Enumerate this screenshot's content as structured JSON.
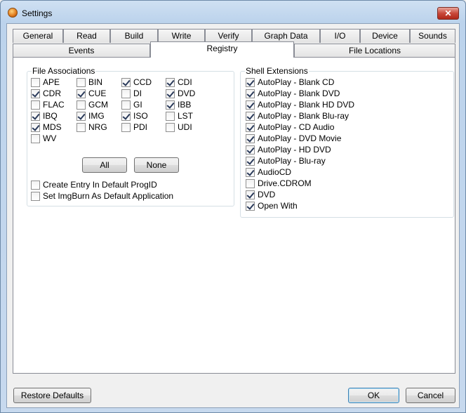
{
  "window": {
    "title": "Settings",
    "close_glyph": "✕"
  },
  "tabs_row1": [
    "General",
    "Read",
    "Build",
    "Write",
    "Verify",
    "Graph Data",
    "I/O",
    "Device",
    "Sounds"
  ],
  "tabs_row2": [
    "Events",
    "Registry",
    "File Locations"
  ],
  "active_tab": "Registry",
  "file_associations": {
    "title": "File Associations",
    "items": [
      {
        "label": "APE",
        "checked": false
      },
      {
        "label": "BIN",
        "checked": false
      },
      {
        "label": "CCD",
        "checked": true
      },
      {
        "label": "CDI",
        "checked": true
      },
      {
        "label": "CDR",
        "checked": true
      },
      {
        "label": "CUE",
        "checked": true
      },
      {
        "label": "DI",
        "checked": false
      },
      {
        "label": "DVD",
        "checked": true
      },
      {
        "label": "FLAC",
        "checked": false
      },
      {
        "label": "GCM",
        "checked": false
      },
      {
        "label": "GI",
        "checked": false
      },
      {
        "label": "IBB",
        "checked": true
      },
      {
        "label": "IBQ",
        "checked": true
      },
      {
        "label": "IMG",
        "checked": true
      },
      {
        "label": "ISO",
        "checked": true
      },
      {
        "label": "LST",
        "checked": false
      },
      {
        "label": "MDS",
        "checked": true
      },
      {
        "label": "NRG",
        "checked": false
      },
      {
        "label": "PDI",
        "checked": false
      },
      {
        "label": "UDI",
        "checked": false
      },
      {
        "label": "WV",
        "checked": false
      }
    ],
    "all_label": "All",
    "none_label": "None",
    "options": [
      {
        "label": "Create Entry In Default ProgID",
        "checked": false
      },
      {
        "label": "Set ImgBurn As Default Application",
        "checked": false
      }
    ]
  },
  "shell_extensions": {
    "title": "Shell Extensions",
    "items": [
      {
        "label": "AutoPlay - Blank CD",
        "checked": true
      },
      {
        "label": "AutoPlay - Blank DVD",
        "checked": true
      },
      {
        "label": "AutoPlay - Blank HD DVD",
        "checked": true
      },
      {
        "label": "AutoPlay - Blank Blu-ray",
        "checked": true
      },
      {
        "label": "AutoPlay - CD Audio",
        "checked": true
      },
      {
        "label": "AutoPlay - DVD Movie",
        "checked": true
      },
      {
        "label": "AutoPlay - HD DVD",
        "checked": true
      },
      {
        "label": "AutoPlay - Blu-ray",
        "checked": true
      },
      {
        "label": "AudioCD",
        "checked": true
      },
      {
        "label": "Drive.CDROM",
        "checked": false
      },
      {
        "label": "DVD",
        "checked": true
      },
      {
        "label": "Open With",
        "checked": true
      }
    ]
  },
  "footer": {
    "restore_label": "Restore Defaults",
    "ok_label": "OK",
    "cancel_label": "Cancel"
  }
}
